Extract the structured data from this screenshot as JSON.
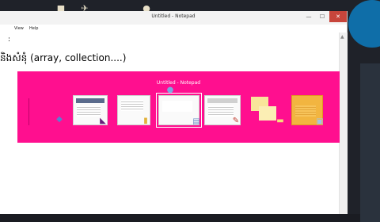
{
  "window": {
    "title": "Untitled - Notepad",
    "controls": {
      "minimize": "—",
      "maximize": "☐",
      "close": "✕"
    }
  },
  "menu": {
    "items": [
      "View",
      "Help"
    ]
  },
  "editor": {
    "lines": [
      ":",
      "និងសំនុំ (array, collection....)"
    ]
  },
  "switcher": {
    "title": "Untitled - Notepad",
    "windows": [
      {
        "icon": "visual-studio-icon",
        "selected": false
      },
      {
        "icon": "visual-studio-icon",
        "selected": false
      },
      {
        "icon": "folder-icon",
        "selected": false
      },
      {
        "icon": "notepad-icon",
        "selected": true
      },
      {
        "icon": "pdf-icon",
        "selected": false
      },
      {
        "icon": "sticky-notes-icon",
        "selected": false
      },
      {
        "icon": "photos-icon",
        "selected": false
      }
    ]
  },
  "colors": {
    "switcher_bg": "#ff0f8f",
    "close_button": "#c7453b"
  }
}
